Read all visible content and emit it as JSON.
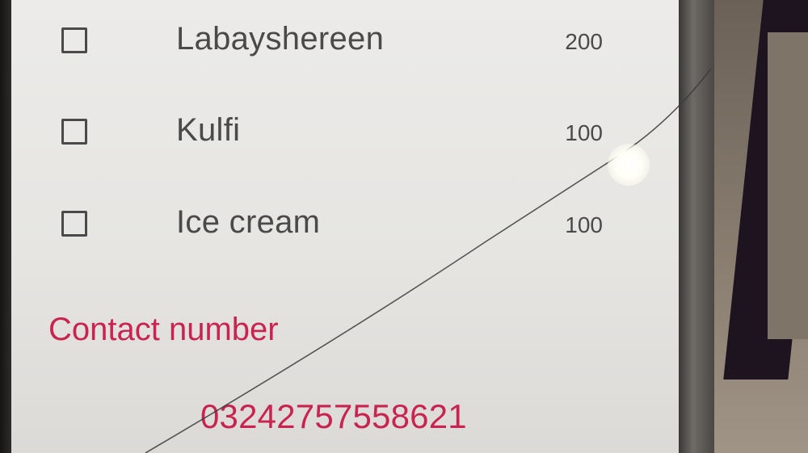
{
  "items": [
    {
      "name": "Labayshereen",
      "price": "200",
      "checked": false
    },
    {
      "name": "Kulfi",
      "price": "100",
      "checked": false
    },
    {
      "name": "Ice cream",
      "price": "100",
      "checked": false
    }
  ],
  "contact": {
    "label": "Contact number",
    "number": "03242757558621"
  },
  "colors": {
    "accent": "#c8244f",
    "text": "#4a4a4a",
    "background": "#ecebe9"
  }
}
